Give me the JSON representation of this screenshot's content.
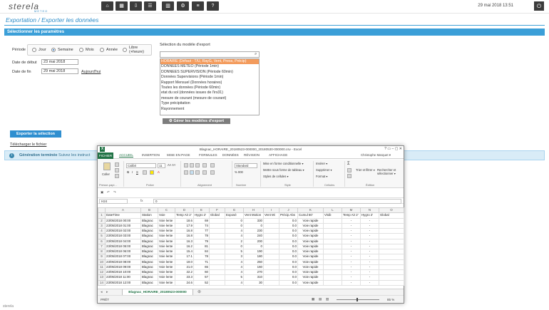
{
  "app": {
    "logo_text": "sterela",
    "logo_sub": "METEO",
    "datetime": "29 mai 2018 13:51"
  },
  "breadcrumb": "Exportation / Exporter les données",
  "section_title": "Sélectionner les paramètres",
  "form": {
    "period_label": "Période",
    "period_options": [
      "Jour",
      "Semaine",
      "Mois",
      "Année",
      "Libre (+heure)"
    ],
    "period_selected": "Semaine",
    "start_label": "Date de début",
    "start_value": "23 mai 2018",
    "end_label": "Date de fin",
    "end_value": "29 mai 2018",
    "today_link": "Aujourd'hui",
    "model_label": "Sélection du modèle d'export",
    "models": [
      "HORAIRE (Défaut : T/U, RayG, Vent, Press, Précip)",
      "DONNEES METEO (Période 1min)",
      "DONNEES SUPERVISION (Période 60min)",
      "Données Supervisions (Période 1min)",
      "Rapport Mensuel (Données horaires)",
      "Toutes les données (Période 60min)",
      "etat du sol (données issues de l'irs31)",
      "mesure de courant (mesure de courant)",
      "Type précipitation",
      "Rayonnement"
    ],
    "manage_button": "Gérer les modèles d'export",
    "export_button": "Exporter la sélection",
    "download_link": "Télécharger le fichier",
    "info_bold": "Génération terminée",
    "info_text": "Suivez les instruct"
  },
  "excel": {
    "title": "Blagnac_HORAIRE_20180523-000000_20180530-000000.csv - Excel",
    "window_controls": "?  ▭  –  ▢  ✕",
    "tabs": [
      "FICHIER",
      "ACCUEIL",
      "INSERTION",
      "MISE EN PAGE",
      "FORMULES",
      "DONNÉES",
      "RÉVISION",
      "AFFICHAGE"
    ],
    "user": "Christophe Marquet ▾",
    "ribbon": {
      "paste": "Coller",
      "font_name": "Calibri",
      "font_size": "11",
      "number_format": "Standard",
      "cond_format": "Mise en forme conditionnelle ▾",
      "table_format": "Mettre sous forme de tableau ▾",
      "cell_styles": "Styles de cellules ▾",
      "insert": "Insérer ▾",
      "delete": "Supprimer ▾",
      "format": "Format ▾",
      "sort_filter": "Trier et filtrer ▾",
      "find_select": "Rechercher et sélectionner ▾",
      "group_clipboard": "Presse-papi...",
      "group_font": "Police",
      "group_align": "Alignement",
      "group_number": "Nombre",
      "group_style": "Style",
      "group_cells": "Cellules",
      "group_edit": "Édition"
    },
    "namebox": "H24",
    "formula": "0",
    "fx": "fx",
    "columns": [
      "",
      "A",
      "B",
      "C",
      "D",
      "E",
      "F",
      "G",
      "H",
      "I",
      "J",
      "K",
      "L",
      "M",
      "N",
      "O"
    ],
    "rows": [
      [
        "1",
        "DateTime",
        "Station",
        "Voie",
        "Temp Air 2'",
        "Hygro 2'",
        "Global",
        "Exposé",
        "Vent Motion",
        "Vent Mi",
        "Précip Abs",
        "Cumul 60'",
        "Visib",
        "Temp Air 2'",
        "Hygro 2'",
        "Global"
      ],
      [
        "2",
        "23/05/2018 00:00",
        "Blagnac",
        "Voie lente",
        "18.6",
        "69",
        "",
        "0",
        "330",
        "",
        "0.0",
        "Voie rapide",
        "",
        "-",
        "-",
        ""
      ],
      [
        "3",
        "23/05/2018 01:00",
        "Blagnac",
        "Voie lente",
        "17.9",
        "74",
        "",
        "0",
        "0",
        "",
        "0.0",
        "Voie rapide",
        "",
        "-",
        "-",
        ""
      ],
      [
        "4",
        "23/05/2018 02:00",
        "Blagnac",
        "Voie lente",
        "16.8",
        "77",
        "",
        "4",
        "230",
        "",
        "0.0",
        "Voie rapide",
        "",
        "-",
        "-",
        ""
      ],
      [
        "5",
        "23/05/2018 03:00",
        "Blagnac",
        "Voie lente",
        "16.8",
        "78",
        "",
        "4",
        "240",
        "",
        "0.0",
        "Voie rapide",
        "",
        "-",
        "-",
        ""
      ],
      [
        "6",
        "23/05/2018 04:00",
        "Blagnac",
        "Voie lente",
        "16.3",
        "79",
        "",
        "2",
        "200",
        "",
        "0.0",
        "Voie rapide",
        "",
        "-",
        "-",
        ""
      ],
      [
        "7",
        "23/05/2018 05:00",
        "Blagnac",
        "Voie lente",
        "16.2",
        "81",
        "",
        "0",
        "0",
        "",
        "0.0",
        "Voie rapide",
        "",
        "-",
        "-",
        ""
      ],
      [
        "8",
        "23/05/2018 06:00",
        "Blagnac",
        "Voie lente",
        "15.4",
        "84",
        "",
        "5",
        "190",
        "",
        "0.0",
        "Voie rapide",
        "",
        "-",
        "-",
        ""
      ],
      [
        "9",
        "23/05/2018 07:00",
        "Blagnac",
        "Voie lente",
        "17.1",
        "78",
        "",
        "3",
        "180",
        "",
        "0.0",
        "Voie rapide",
        "",
        "-",
        "-",
        ""
      ],
      [
        "10",
        "23/05/2018 08:00",
        "Blagnac",
        "Voie lente",
        "19.0",
        "71",
        "",
        "4",
        "250",
        "",
        "0.0",
        "Voie rapide",
        "",
        "-",
        "-",
        ""
      ],
      [
        "11",
        "23/05/2018 09:00",
        "Blagnac",
        "Voie lente",
        "21.0",
        "65",
        "",
        "4",
        "160",
        "",
        "0.0",
        "Voie rapide",
        "",
        "-",
        "-",
        ""
      ],
      [
        "12",
        "23/05/2018 10:00",
        "Blagnac",
        "Voie lente",
        "22.2",
        "60",
        "",
        "4",
        "270",
        "",
        "0.0",
        "Voie rapide",
        "",
        "-",
        "-",
        ""
      ],
      [
        "13",
        "23/05/2018 11:00",
        "Blagnac",
        "Voie lente",
        "23.3",
        "57",
        "",
        "5",
        "310",
        "",
        "0.0",
        "Voie rapide",
        "",
        "-",
        "-",
        ""
      ],
      [
        "14",
        "23/05/2018 12:00",
        "Blagnac",
        "Voie lente",
        "24.6",
        "52",
        "",
        "4",
        "30",
        "",
        "0.0",
        "Voie rapide",
        "",
        "-",
        "-",
        ""
      ]
    ],
    "sheet_tab": "Blagnac_HORAIRE_20180523-000000",
    "status_left": "PRÊT",
    "zoom": "85 %"
  }
}
